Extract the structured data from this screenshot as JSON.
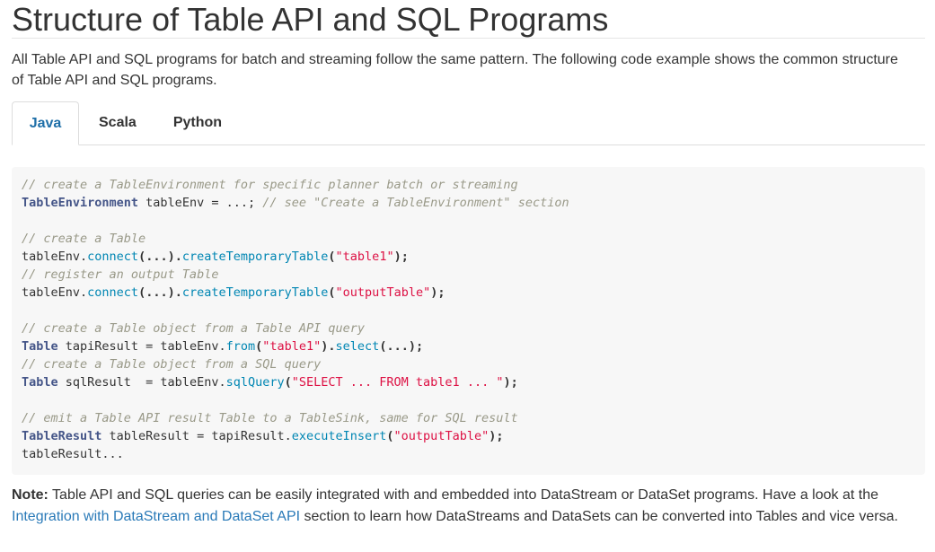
{
  "title": "Structure of Table API and SQL Programs",
  "intro": "All Table API and SQL programs for batch and streaming follow the same pattern. The following code example shows the common structure of Table API and SQL programs.",
  "tabs": [
    {
      "label": "Java",
      "active": true
    },
    {
      "label": "Scala",
      "active": false
    },
    {
      "label": "Python",
      "active": false
    }
  ],
  "code": {
    "l1_comment": "// create a TableEnvironment for specific planner batch or streaming",
    "l2_type": "TableEnvironment",
    "l2_rest": " tableEnv = ...; ",
    "l2_comment": "// see \"Create a TableEnvironment\" section",
    "l4_comment": "// create a Table",
    "l5_obj": "tableEnv.",
    "l5_f1": "connect",
    "l5_mid": "(...).",
    "l5_f2": "createTemporaryTable",
    "l5_open": "(",
    "l5_str": "\"table1\"",
    "l5_close": ");",
    "l6_comment": "// register an output Table",
    "l7_obj": "tableEnv.",
    "l7_f1": "connect",
    "l7_mid": "(...).",
    "l7_f2": "createTemporaryTable",
    "l7_open": "(",
    "l7_str": "\"outputTable\"",
    "l7_close": ");",
    "l9_comment": "// create a Table object from a Table API query",
    "l10_type": "Table",
    "l10_rest": " tapiResult = tableEnv.",
    "l10_f1": "from",
    "l10_open": "(",
    "l10_str": "\"table1\"",
    "l10_mid": ").",
    "l10_f2": "select",
    "l10_close": "(...);",
    "l11_comment": "// create a Table object from a SQL query",
    "l12_type": "Table",
    "l12_rest": " sqlResult  = tableEnv.",
    "l12_f1": "sqlQuery",
    "l12_open": "(",
    "l12_str": "\"SELECT ... FROM table1 ... \"",
    "l12_close": ");",
    "l14_comment": "// emit a Table API result Table to a TableSink, same for SQL result",
    "l15_type": "TableResult",
    "l15_rest": " tableResult = tapiResult.",
    "l15_f1": "executeInsert",
    "l15_open": "(",
    "l15_str": "\"outputTable\"",
    "l15_close": ");",
    "l16_obj": "tableResult...",
    "colors": {
      "comment": "#999988",
      "type": "#445588",
      "function": "#0086b3",
      "string": "#dd1144",
      "background": "#f7f7f7"
    }
  },
  "note": {
    "label": "Note:",
    "text1": " Table API and SQL queries can be easily integrated with and embedded into DataStream or DataSet programs. Have a look at the ",
    "link": "Integration with DataStream and DataSet API",
    "text2": " section to learn how DataStreams and DataSets can be converted into Tables and vice versa."
  }
}
